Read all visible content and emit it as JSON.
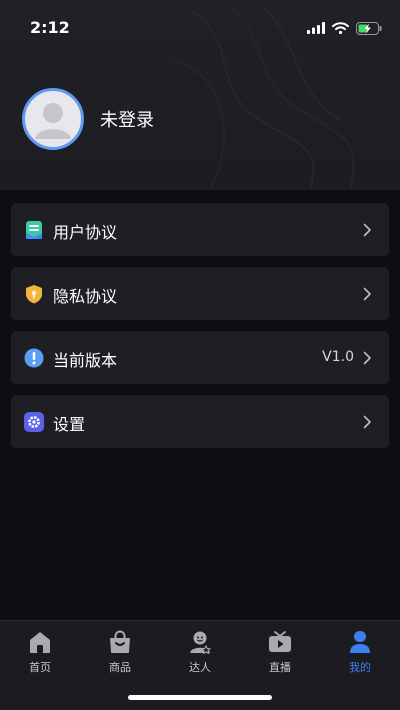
{
  "status_bar": {
    "time": "2:12",
    "icons": [
      "signal-icon",
      "wifi-icon",
      "battery-charging-icon"
    ]
  },
  "profile": {
    "login_label": "未登录",
    "avatar_icon": "default-avatar-icon"
  },
  "menu": {
    "items": [
      {
        "label": "用户协议",
        "icon": "user-agreement-icon",
        "value": ""
      },
      {
        "label": "隐私协议",
        "icon": "privacy-shield-icon",
        "value": ""
      },
      {
        "label": "当前版本",
        "icon": "info-exclamation-icon",
        "value": "V1.0"
      },
      {
        "label": "设置",
        "icon": "settings-gear-icon",
        "value": ""
      }
    ]
  },
  "tabbar": {
    "tabs": [
      {
        "label": "首页",
        "icon": "home-icon",
        "active": false
      },
      {
        "label": "商品",
        "icon": "shopping-bag-icon",
        "active": false
      },
      {
        "label": "达人",
        "icon": "influencer-icon",
        "active": false
      },
      {
        "label": "直播",
        "icon": "live-tv-icon",
        "active": false
      },
      {
        "label": "我的",
        "icon": "profile-icon",
        "active": true
      }
    ]
  },
  "colors": {
    "background": "#0e0d12",
    "card": "#1f1e25",
    "accent": "#3d7ff3",
    "avatar_ring": "#5f9af0"
  }
}
